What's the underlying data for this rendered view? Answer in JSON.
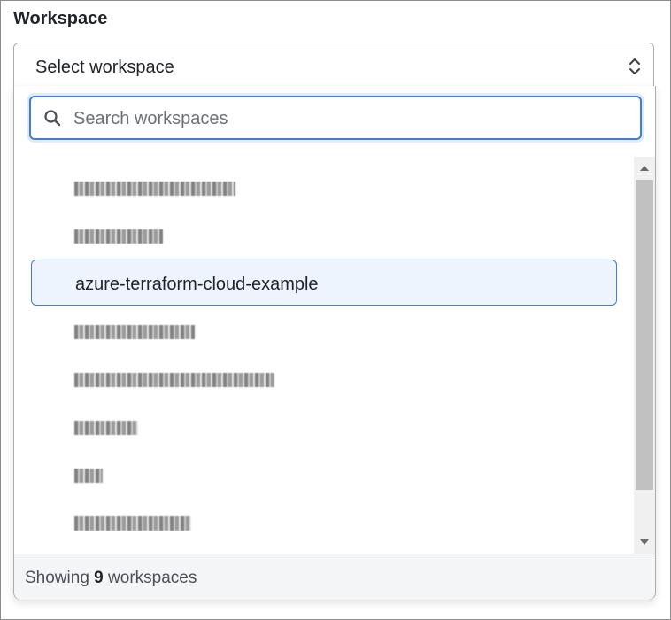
{
  "field": {
    "label": "Workspace"
  },
  "select": {
    "value": "Select workspace",
    "chevron_icon": "up-down-chevron-icon"
  },
  "search": {
    "placeholder": "Search workspaces",
    "value": "",
    "icon": "search-icon"
  },
  "workspaces": [
    {
      "label": "",
      "redacted": true,
      "redacted_width": 182
    },
    {
      "label": "",
      "redacted": true,
      "redacted_width": 100
    },
    {
      "label": "azure-terraform-cloud-example",
      "redacted": false,
      "selected": true
    },
    {
      "label": "",
      "redacted": true,
      "redacted_width": 136
    },
    {
      "label": "",
      "redacted": true,
      "redacted_width": 226
    },
    {
      "label": "",
      "redacted": true,
      "redacted_width": 72
    },
    {
      "label": "",
      "redacted": true,
      "redacted_width": 32
    },
    {
      "label": "",
      "redacted": true,
      "redacted_width": 132
    }
  ],
  "footer": {
    "prefix": "Showing",
    "count": "9",
    "suffix": "workspaces"
  },
  "colors": {
    "accent": "#3f7be6",
    "selected_bg": "#edf4fd"
  }
}
